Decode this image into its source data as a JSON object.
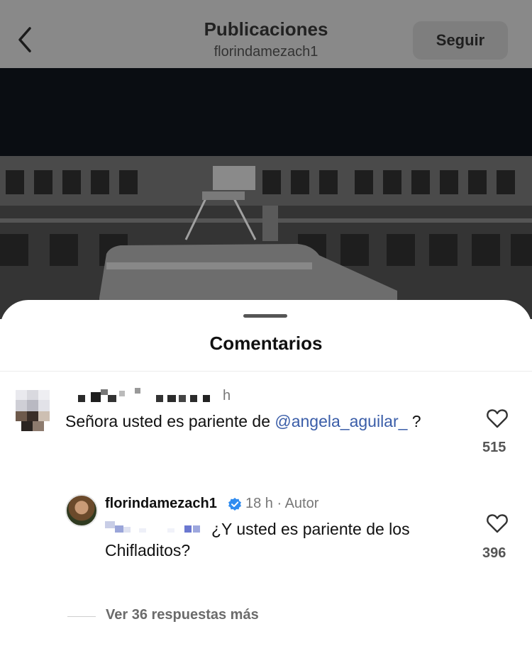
{
  "header": {
    "title": "Publicaciones",
    "username": "florindamezach1",
    "follow_label": "Seguir",
    "back_icon": "chevron-left-icon"
  },
  "comments_sheet": {
    "title": "Comentarios",
    "comment": {
      "time": "h",
      "text_before": "Señora usted es pariente de ",
      "mention": "@angela_aguilar_",
      "text_after": " ?",
      "likes": "515"
    },
    "reply": {
      "username": "florindamezach1",
      "time_label": "18 h · Autor",
      "text_line1": "¿Y usted es pariente de los",
      "text_line2": "Chifladitos?",
      "likes": "396"
    },
    "view_more": "Ver 36 respuestas más"
  },
  "colors": {
    "mention": "#3a5da8",
    "verified": "#2f8cf0"
  }
}
